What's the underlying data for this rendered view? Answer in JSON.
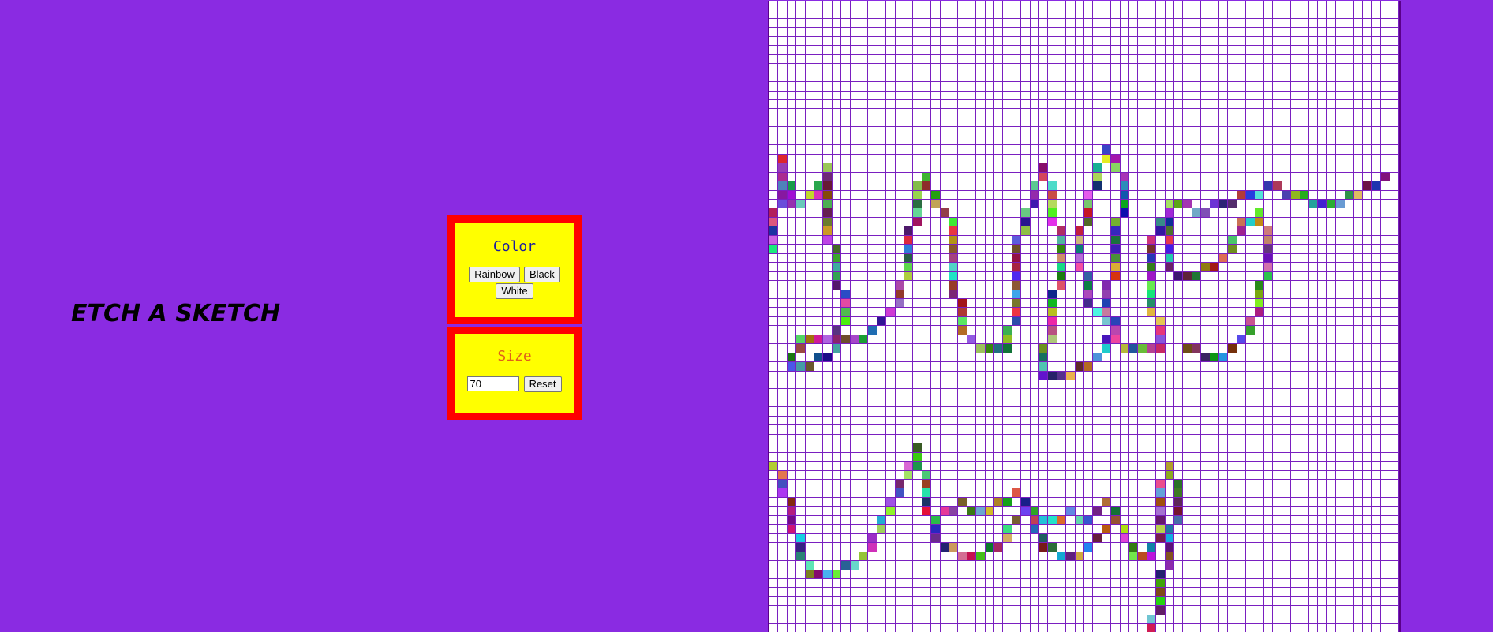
{
  "title": "ETCH A SKETCH",
  "color_panel": {
    "heading": "Color",
    "rainbow_label": "Rainbow",
    "black_label": "Black",
    "white_label": "White"
  },
  "size_panel": {
    "heading": "Size",
    "size_value": "70",
    "reset_label": "Reset"
  },
  "grid": {
    "size": 70,
    "line_color": "#7a1fc0",
    "background": "#ffffff"
  },
  "colors": {
    "page_background": "#8a2be2",
    "panel_background": "#ffff00",
    "panel_border": "#ff0000"
  }
}
